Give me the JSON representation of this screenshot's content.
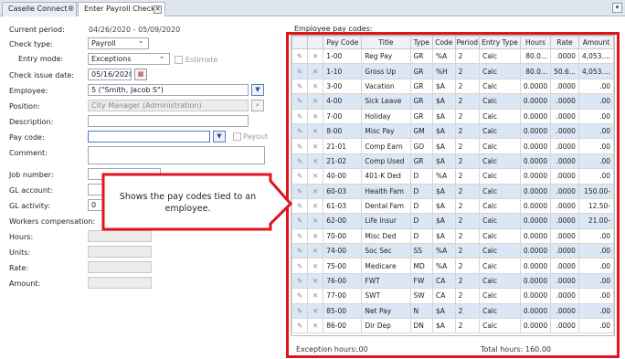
{
  "tabs": [
    {
      "label": "Caselle Connect®"
    },
    {
      "label": "Enter Payroll Checks"
    }
  ],
  "form": {
    "current_period_label": "Current period:",
    "current_period_value": "04/26/2020 - 05/09/2020",
    "check_type_label": "Check type:",
    "check_type_value": "Payroll",
    "entry_mode_label": "Entry mode:",
    "entry_mode_value": "Exceptions",
    "estimate_label": "Estimate",
    "check_issue_date_label": "Check issue date:",
    "check_issue_date_value": "05/16/2020",
    "employee_label": "Employee:",
    "employee_value": "5 (\"Smith, Jacob S\")",
    "position_label": "Position:",
    "position_value": "City Manager (Administration)",
    "description_label": "Description:",
    "pay_code_label": "Pay code:",
    "payout_label": "Payout",
    "comment_label": "Comment:",
    "job_number_label": "Job number:",
    "gl_account_label": "GL account:",
    "gl_activity_label": "GL activity:",
    "gl_activity_value": "0",
    "workers_comp_label": "Workers compensation:",
    "hours_label": "Hours:",
    "units_label": "Units:",
    "rate_label": "Rate:",
    "amount_label": "Amount:"
  },
  "grid": {
    "title": "Employee pay codes:",
    "columns": [
      "Pay Code",
      "Title",
      "Type",
      "Code",
      "Period",
      "Entry Type",
      "Hours",
      "Rate",
      "Amount"
    ],
    "rows": [
      [
        "1-00",
        "Reg Pay",
        "GR",
        "%A",
        "2",
        "Calc",
        "80.0...",
        ".0000",
        "4,053...."
      ],
      [
        "1-10",
        "Gross Up",
        "GR",
        "%H",
        "2",
        "Calc",
        "80.0...",
        "50.6...",
        "4,053...."
      ],
      [
        "3-00",
        "Vacation",
        "GR",
        "$A",
        "2",
        "Calc",
        "0.0000",
        ".0000",
        ".00"
      ],
      [
        "4-00",
        "Sick Leave",
        "GR",
        "$A",
        "2",
        "Calc",
        "0.0000",
        ".0000",
        ".00"
      ],
      [
        "7-00",
        "Holiday",
        "GR",
        "$A",
        "2",
        "Calc",
        "0.0000",
        ".0000",
        ".00"
      ],
      [
        "8-00",
        "Misc Pay",
        "GM",
        "$A",
        "2",
        "Calc",
        "0.0000",
        ".0000",
        ".00"
      ],
      [
        "21-01",
        "Comp Earn",
        "GO",
        "$A",
        "2",
        "Calc",
        "0.0000",
        ".0000",
        ".00"
      ],
      [
        "21-02",
        "Comp Used",
        "GR",
        "$A",
        "2",
        "Calc",
        "0.0000",
        ".0000",
        ".00"
      ],
      [
        "40-00",
        "401-K Ded",
        "D",
        "%A",
        "2",
        "Calc",
        "0.0000",
        ".0000",
        ".00"
      ],
      [
        "60-03",
        "Health Fam",
        "D",
        "$A",
        "2",
        "Calc",
        "0.0000",
        ".0000",
        "150.00-"
      ],
      [
        "61-03",
        "Dental Fam",
        "D",
        "$A",
        "2",
        "Calc",
        "0.0000",
        ".0000",
        "12.50-"
      ],
      [
        "62-00",
        "Life Insur",
        "D",
        "$A",
        "2",
        "Calc",
        "0.0000",
        ".0000",
        "21.00-"
      ],
      [
        "70-00",
        "Misc Ded",
        "D",
        "$A",
        "2",
        "Calc",
        "0.0000",
        ".0000",
        ".00"
      ],
      [
        "74-00",
        "Soc Sec",
        "SS",
        "%A",
        "2",
        "Calc",
        "0.0000",
        ".0000",
        ".00"
      ],
      [
        "75-00",
        "Medicare",
        "MD",
        "%A",
        "2",
        "Calc",
        "0.0000",
        ".0000",
        ".00"
      ],
      [
        "76-00",
        "FWT",
        "FW",
        "CA",
        "2",
        "Calc",
        "0.0000",
        ".0000",
        ".00"
      ],
      [
        "77-00",
        "SWT",
        "SW",
        "CA",
        "2",
        "Calc",
        "0.0000",
        ".0000",
        ".00"
      ],
      [
        "85-00",
        "Net Pay",
        "N",
        "$A",
        "2",
        "Calc",
        "0.0000",
        ".0000",
        ".00"
      ],
      [
        "86-00",
        "Dir Dep",
        "DN",
        "$A",
        "2",
        "Calc",
        "0.0000",
        ".0000",
        ".00"
      ]
    ]
  },
  "footer": {
    "exception_hours_label": "Exception hours:",
    "exception_hours_value": ".00",
    "total_hours_label": "Total hours:",
    "total_hours_value": "160.00"
  },
  "callout": {
    "text": "Shows the pay codes tied to an employee.",
    "color": "#e0141c"
  },
  "icons": {
    "edit": "pencil-icon",
    "delete": "x-icon",
    "calendar": "calendar-icon",
    "binoculars": "binoculars-icon"
  }
}
